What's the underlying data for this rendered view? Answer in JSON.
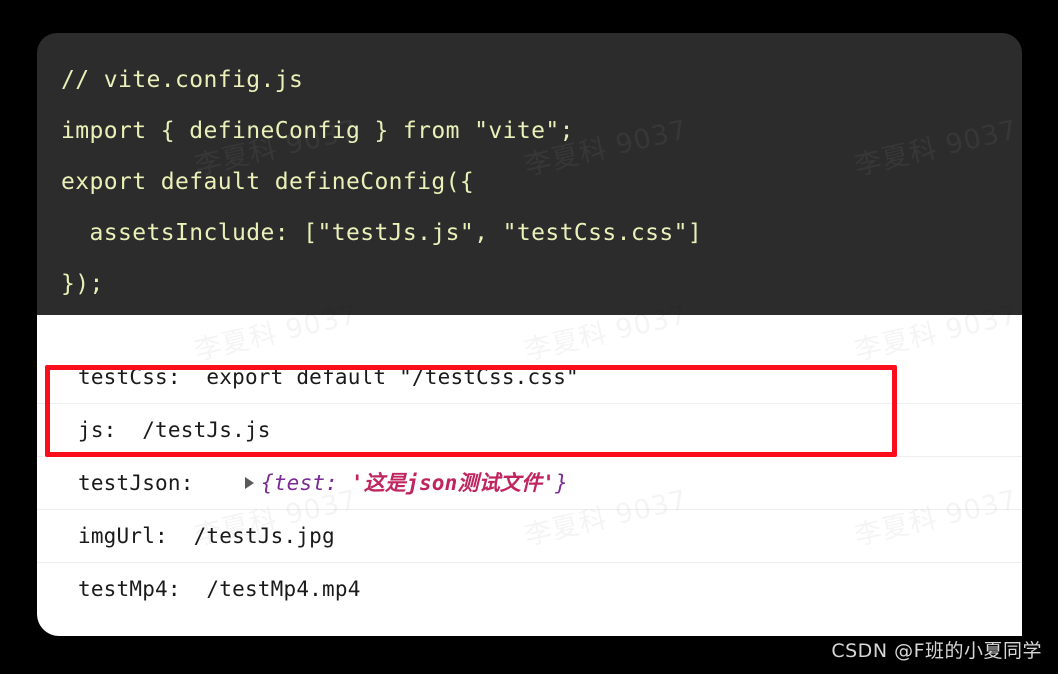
{
  "page": {
    "background_color": "#000000",
    "watermark_text": "李夏科 9037",
    "credit": "CSDN @F班的小夏同学"
  },
  "code_panel": {
    "background_color": "#2c2c2c",
    "text_color": "#eaf0b8",
    "lines": [
      "// vite.config.js",
      "import { defineConfig } from \"vite\";",
      "export default defineConfig({",
      "  assetsInclude: [\"testJs.js\", \"testCss.css\"]",
      "});"
    ]
  },
  "console_panel": {
    "background_color": "#ffffff",
    "rows": [
      {
        "key": "testCss:",
        "value": "  export default \"/testCss.css\"",
        "has_expander": false,
        "highlighted": true
      },
      {
        "key": "js:",
        "value": "  /testJs.js",
        "has_expander": false,
        "highlighted": true
      },
      {
        "key": "testJson:",
        "value_brace_open": "{",
        "value_key": "test:",
        "value_string": " '这是json测试文件'",
        "value_brace_close": "}",
        "has_expander": true,
        "expander_glyph": "▶",
        "highlighted": false
      },
      {
        "key": "imgUrl:",
        "value": "  /testJs.jpg",
        "has_expander": false,
        "highlighted": false
      },
      {
        "key": "testMp4:",
        "value": "  /testMp4.mp4",
        "has_expander": false,
        "highlighted": false
      }
    ]
  },
  "annotation": {
    "red_box_color": "#fc0d1b",
    "covers_rows": [
      "testCss:",
      "js:"
    ]
  }
}
